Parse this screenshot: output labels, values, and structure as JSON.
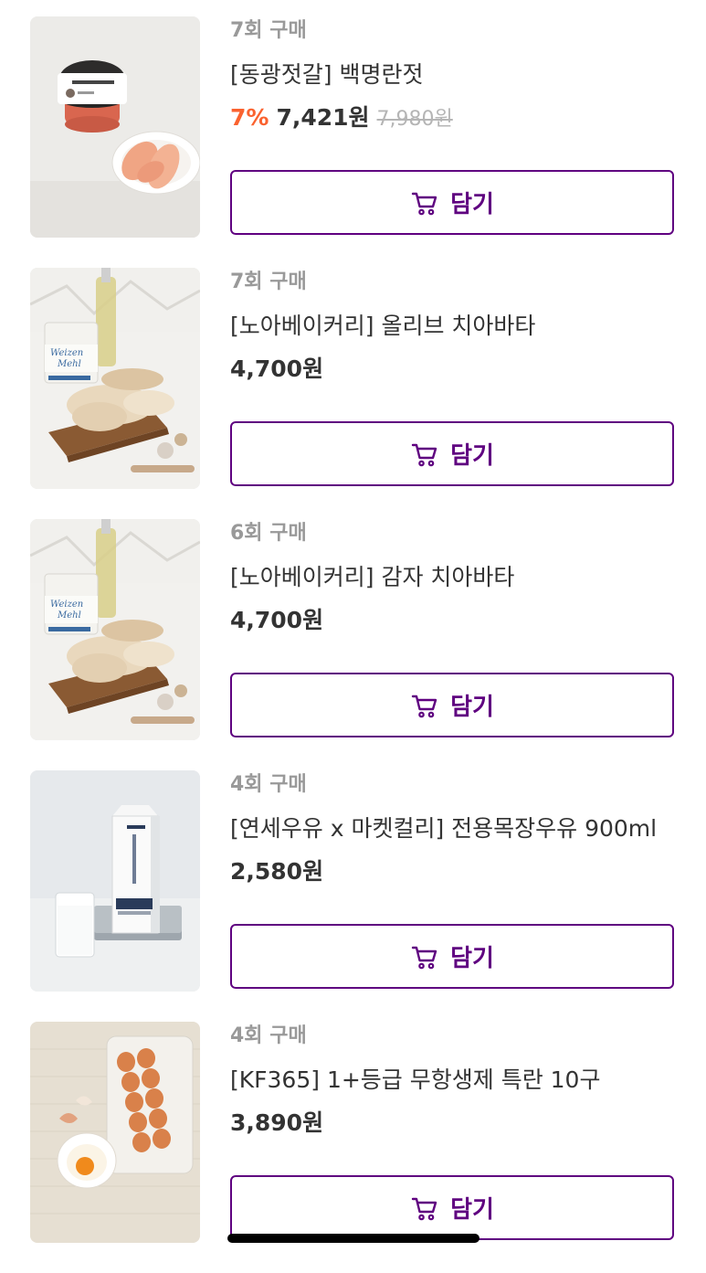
{
  "colors": {
    "accent": "#5f0080",
    "discount": "#fa622f",
    "muted": "#999999",
    "text": "#333333"
  },
  "products": [
    {
      "purchase_count": "7회 구매",
      "name": "[동광젓갈] 백명란젓",
      "discount": "7%",
      "price": "7,421원",
      "original_price": "7,980원",
      "cart_label": "담기",
      "image": "pollack-roe-jar"
    },
    {
      "purchase_count": "7회 구매",
      "name": "[노아베이커리] 올리브 치아바타",
      "discount": "",
      "price": "4,700원",
      "original_price": "",
      "cart_label": "담기",
      "image": "ciabatta-bread"
    },
    {
      "purchase_count": "6회 구매",
      "name": "[노아베이커리] 감자 치아바타",
      "discount": "",
      "price": "4,700원",
      "original_price": "",
      "cart_label": "담기",
      "image": "ciabatta-bread"
    },
    {
      "purchase_count": "4회 구매",
      "name": "[연세우유 x 마켓컬리] 전용목장우유 900ml",
      "discount": "",
      "price": "2,580원",
      "original_price": "",
      "cart_label": "담기",
      "image": "milk-carton"
    },
    {
      "purchase_count": "4회 구매",
      "name": "[KF365] 1+등급 무항생제 특란 10구",
      "discount": "",
      "price": "3,890원",
      "original_price": "",
      "cart_label": "담기",
      "image": "eggs-tray"
    }
  ]
}
